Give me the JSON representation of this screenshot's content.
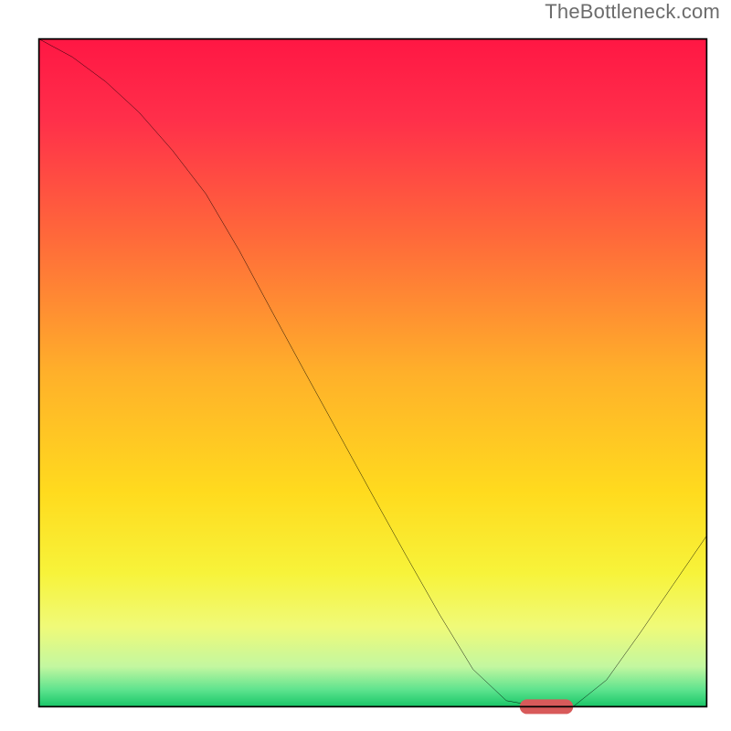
{
  "watermark": "TheBottleneck.com",
  "chart_data": {
    "type": "line",
    "title": "",
    "xlabel": "",
    "ylabel": "",
    "xlim": [
      0,
      100
    ],
    "ylim": [
      0,
      100
    ],
    "grid": false,
    "legend": false,
    "series": [
      {
        "name": "curve",
        "x": [
          0,
          5,
          10,
          15,
          20,
          25,
          30,
          35,
          40,
          45,
          50,
          55,
          60,
          65,
          70,
          75,
          80,
          85,
          90,
          95,
          100
        ],
        "y": [
          100,
          97.3,
          93.6,
          89.0,
          83.3,
          76.8,
          68.3,
          59.0,
          49.8,
          40.7,
          31.6,
          22.6,
          13.8,
          5.6,
          0.9,
          0.0,
          0.0,
          4.0,
          11.0,
          18.3,
          25.6
        ]
      }
    ],
    "marker": {
      "name": "optimal-zone",
      "x_range": [
        72,
        80
      ],
      "y": 0,
      "color": "#d85a5a"
    },
    "background_gradient": {
      "stops": [
        {
          "pos": 0.0,
          "color": "#ff1744"
        },
        {
          "pos": 0.12,
          "color": "#ff2f4a"
        },
        {
          "pos": 0.3,
          "color": "#ff6a3a"
        },
        {
          "pos": 0.5,
          "color": "#ffb02a"
        },
        {
          "pos": 0.68,
          "color": "#ffdb1e"
        },
        {
          "pos": 0.8,
          "color": "#f7f33a"
        },
        {
          "pos": 0.88,
          "color": "#f0fa78"
        },
        {
          "pos": 0.94,
          "color": "#c3f7a0"
        },
        {
          "pos": 0.975,
          "color": "#5de38e"
        },
        {
          "pos": 1.0,
          "color": "#18c667"
        }
      ]
    }
  }
}
